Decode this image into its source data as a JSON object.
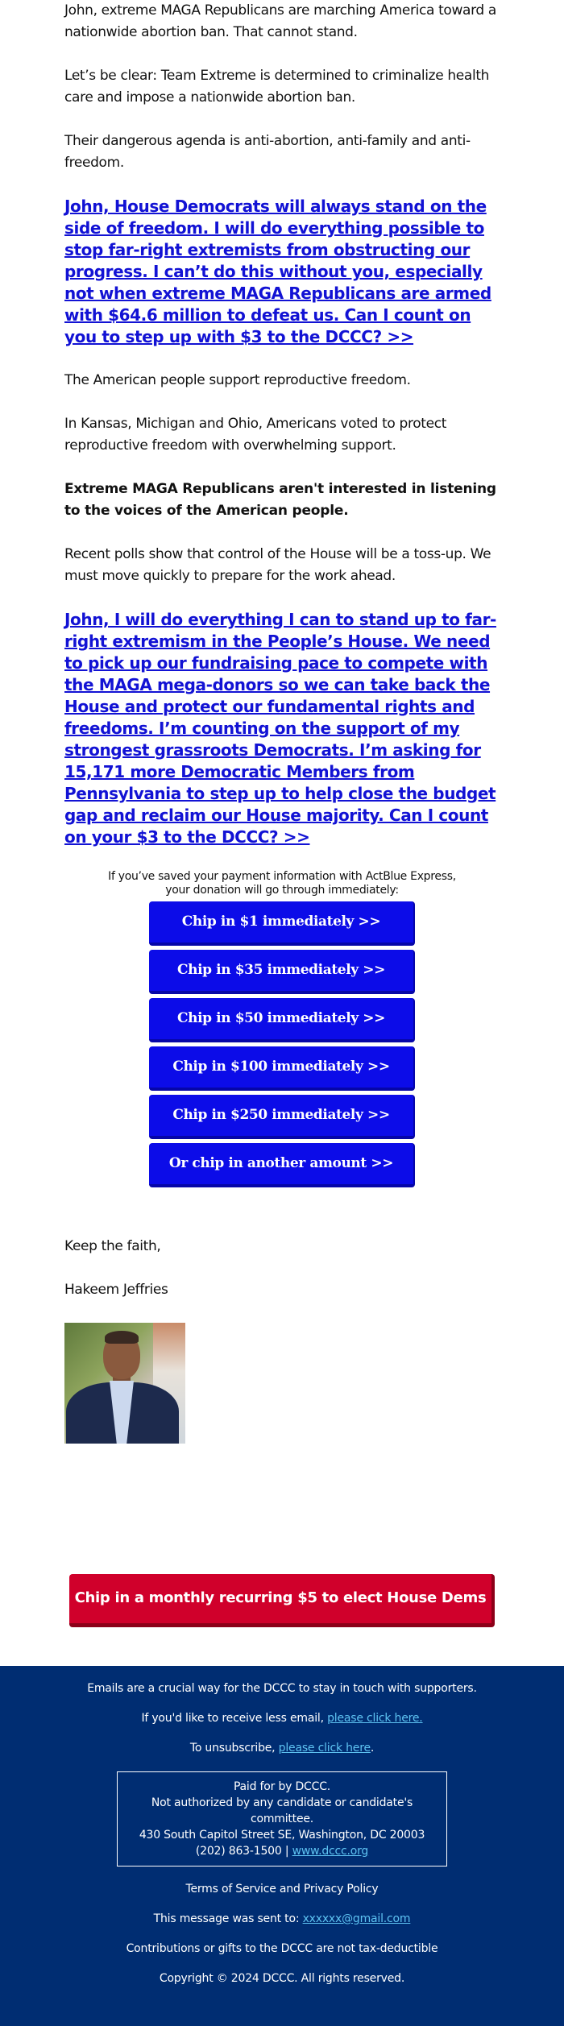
{
  "body": {
    "paragraphs_top": [
      "John, extreme MAGA Republicans are marching America toward a nationwide abortion ban. That cannot stand.",
      "Let’s be clear: Team Extreme is determined to criminalize health care and impose a nationwide abortion ban.",
      "Their dangerous agenda is anti-abortion, anti-family and anti-freedom."
    ],
    "cta_link_1": "John, House Democrats will always stand on the side of freedom. I will do everything possible to stop far-right extremists from obstructing our progress. I can’t do this without you, especially not when extreme MAGA Republicans are armed with $64.6 million to defeat us. Can I count on you to step up with $3 to the DCCC? >>",
    "paragraphs_middle": [
      "The American people support reproductive freedom.",
      "In Kansas, Michigan and Ohio, Americans voted to protect reproductive freedom with overwhelming support."
    ],
    "bold_paragraph": "Extreme MAGA Republicans aren't interested in listening to the voices of the American people.",
    "paragraph_polls": "Recent polls show that control of the House will be a toss-up. We must move quickly to prepare for the work ahead.",
    "cta_link_2": "John, I will do everything I can to stand up to far-right extremism in the People’s House. We need to pick up our fundraising pace to compete with the MAGA mega-donors so we can take back the House and protect our fundamental rights and freedoms. I’m counting on the support of my strongest grassroots Democrats. I’m asking for 15,171 more Democratic Members from Pennsylvania to step up to help close the budget gap and reclaim our House majority. Can I count on your $3 to the DCCC? >>"
  },
  "donate": {
    "note_line_1": "If you’ve saved your payment information with ActBlue Express,",
    "note_line_2": "your donation will go through immediately:",
    "buttons": [
      {
        "label": "Chip in $1 immediately >>"
      },
      {
        "label": "Chip in $35 immediately >>"
      },
      {
        "label": "Chip in $50 immediately >>"
      },
      {
        "label": "Chip in $100 immediately >>"
      },
      {
        "label": "Chip in $250 immediately >>"
      },
      {
        "label": "Or chip in another amount >>"
      }
    ],
    "button_color": "#0c0ce8"
  },
  "signature": {
    "closing": "Keep the faith,",
    "name": "Hakeem Jeffries"
  },
  "recurring": {
    "label": "Chip in a monthly recurring $5 to elect House Dems >>",
    "color": "#d0002b"
  },
  "footer": {
    "intro": "Emails are a crucial way for the DCCC to stay in touch with supporters.",
    "less_email_prefix": "If you'd like to receive less email, ",
    "less_email_link": "please click here.",
    "unsubscribe_prefix": "To unsubscribe, ",
    "unsubscribe_link": "please click here",
    "unsubscribe_suffix": ".",
    "legal": {
      "paid_for": "Paid for by DCCC.",
      "not_authorized": "Not authorized by any candidate or candidate's committee.",
      "address": "430 South Capitol Street SE, Washington, DC 20003",
      "phone": "(202) 863-1500",
      "separator": " | ",
      "website": "www.dccc.org"
    },
    "terms": "Terms of Service and Privacy Policy",
    "sent_to_prefix": "This message was sent to: ",
    "sent_to_email": "xxxxxx@gmail.com",
    "tax_note": "Contributions or gifts to the DCCC are not tax-deductible",
    "copyright": "Copyright © 2024 DCCC. All rights reserved.",
    "background_color": "#002d72",
    "link_color": "#5ec3f2"
  }
}
